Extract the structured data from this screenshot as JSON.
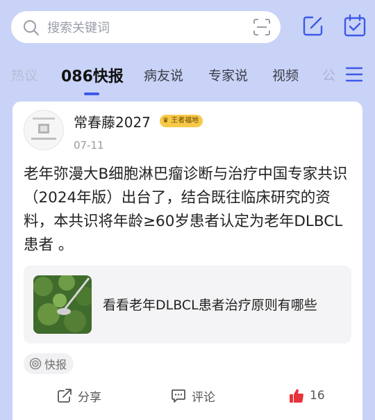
{
  "search": {
    "placeholder": "搜索关键词"
  },
  "header": {
    "icons": [
      "edit-icon",
      "calendar-check-icon"
    ]
  },
  "tabs": [
    {
      "label": "热议"
    },
    {
      "label": "086快报",
      "active": true
    },
    {
      "label": "病友说"
    },
    {
      "label": "专家说"
    },
    {
      "label": "视频"
    },
    {
      "label": "公"
    }
  ],
  "post": {
    "author": "常春藤2027",
    "badge": "王者福地",
    "date": "07-11",
    "content": "老年弥漫大B细胞淋巴瘤诊断与治疗中国专家共识（2024年版）出台了，结合既往临床研究的资料，本共识将年龄≥60岁患者认定为老年DLBCL患者 。",
    "link_title": "看看老年DLBCL患者治疗原则有哪些",
    "tag": "快报",
    "actions": {
      "share": "分享",
      "comment": "评论",
      "likes": "16"
    }
  },
  "colors": {
    "header_bg": "#c9d3f7",
    "accent": "#3c59e8",
    "like": "#e8333a"
  }
}
